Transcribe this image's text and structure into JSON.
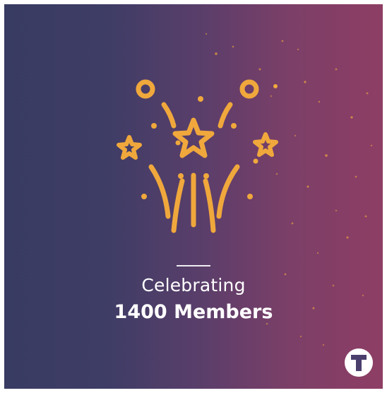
{
  "card": {
    "line1": "Celebrating",
    "line2": "1400 Members"
  },
  "logo": {
    "letter": "T"
  },
  "colors": {
    "accent": "#f0a83c",
    "gradient_left": "#383b62",
    "gradient_right": "#8e3e64",
    "text": "#ffffff"
  },
  "icons": {
    "main": "fireworks-icon",
    "brand": "t-logo-icon"
  }
}
